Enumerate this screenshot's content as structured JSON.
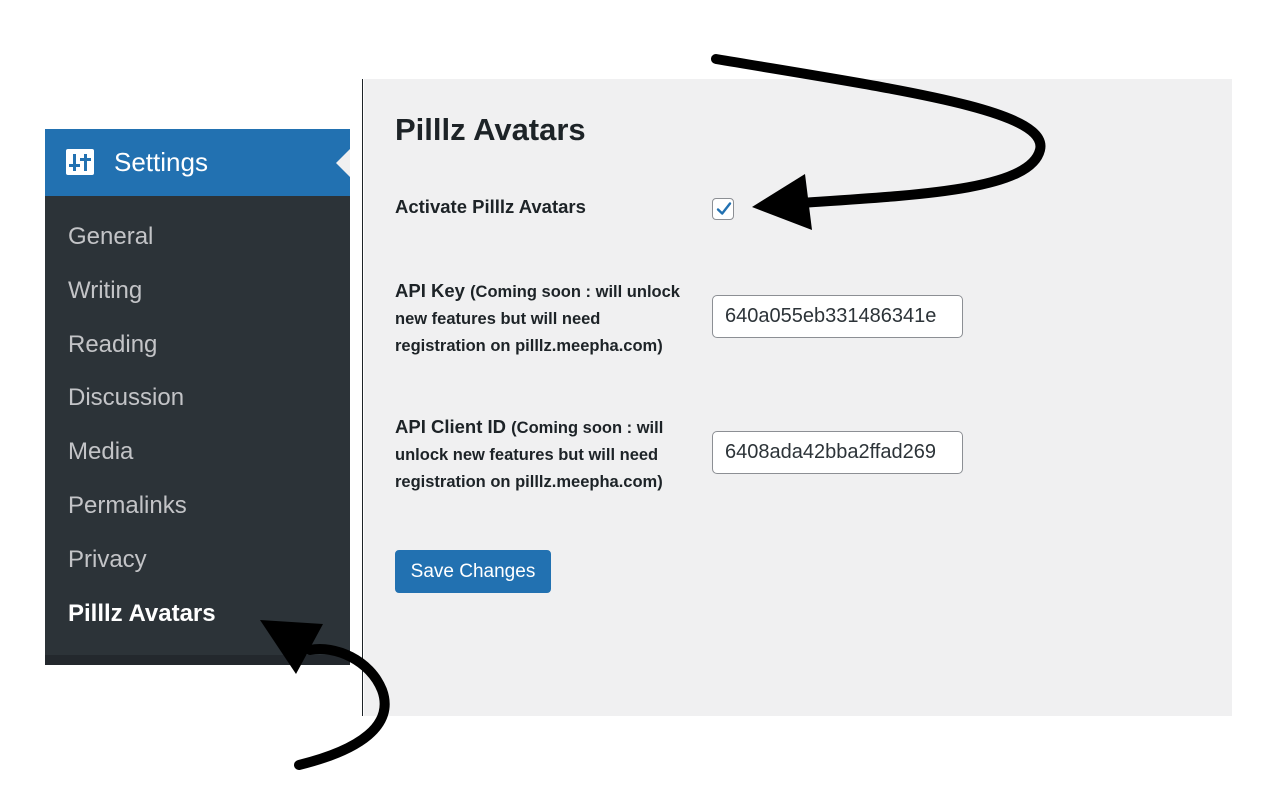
{
  "sidebar": {
    "header": {
      "icon": "settings-icon",
      "label": "Settings"
    },
    "items": [
      {
        "label": "General"
      },
      {
        "label": "Writing"
      },
      {
        "label": "Reading"
      },
      {
        "label": "Discussion"
      },
      {
        "label": "Media"
      },
      {
        "label": "Permalinks"
      },
      {
        "label": "Privacy"
      },
      {
        "label": "Pilllz Avatars",
        "active": true
      }
    ]
  },
  "main": {
    "title": "Pilllz Avatars",
    "activate": {
      "label": "Activate Pilllz Avatars",
      "checked": true
    },
    "api_key": {
      "label": "API Key",
      "note": "(Coming soon : will unlock new features but will need registration on pilllz.meepha.com)",
      "value": "640a055eb331486341e"
    },
    "api_client_id": {
      "label": "API Client ID",
      "note": "(Coming soon : will unlock new features but will need registration on pilllz.meepha.com)",
      "value": "6408ada42bba2ffad269"
    },
    "save_label": "Save Changes"
  },
  "colors": {
    "accent": "#2271b1",
    "sidebar_bg": "#2c3338",
    "panel_bg": "#f0f0f1",
    "menu_text": "#c3c4c7",
    "annotation_arrow": "#000000"
  }
}
